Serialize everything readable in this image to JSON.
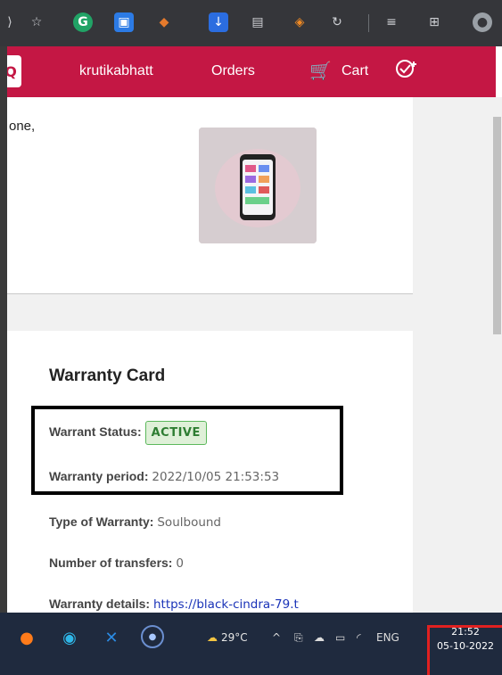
{
  "browser": {
    "icons": [
      "chevron-right-icon",
      "star-add-icon",
      "grammarly-icon",
      "screen-record-icon",
      "drop-icon",
      "download-icon",
      "extension-icon",
      "fox-icon",
      "refresh-cycle-icon",
      "favorites-icon",
      "collections-icon",
      "profile-icon"
    ]
  },
  "nav": {
    "username": "krutikabhatt",
    "orders_label": "Orders",
    "cart_label": "Cart"
  },
  "product": {
    "name_fragment": "one,"
  },
  "warranty": {
    "title": "Warranty Card",
    "status_label": "Warrant Status:",
    "status_value": "ACTIVE",
    "period_label": "Warranty period:",
    "period_value": "2022/10/05 21:53:53",
    "type_label": "Type of Warranty:",
    "type_value": "Soulbound",
    "transfers_label": "Number of transfers:",
    "transfers_value": "0",
    "details_label": "Warranty details:",
    "details_value": "https://black-cindra-79.t"
  },
  "taskbar": {
    "temperature": "29°C",
    "language": "ENG",
    "time": "21:52",
    "date": "05-10-2022"
  },
  "colors": {
    "brand": "#c41744",
    "status_active": "#2e7d32",
    "link": "#1a33b8"
  }
}
